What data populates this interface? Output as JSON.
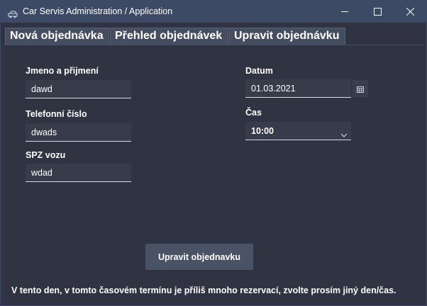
{
  "window": {
    "title": "Car Servis Administration / Application",
    "icon": "car-app-icon",
    "controls": {
      "minimize_icon": "minimize-icon",
      "maximize_icon": "maximize-icon",
      "close_icon": "close-icon"
    }
  },
  "tabs": [
    {
      "label": "Nová objednávka"
    },
    {
      "label": "Přehled objednávek"
    },
    {
      "label": "Upravit objednávku"
    }
  ],
  "form": {
    "name": {
      "label": "Jmeno a přijmení",
      "value": "dawd"
    },
    "phone": {
      "label": "Telefonní číslo",
      "value": "dwads"
    },
    "plate": {
      "label": "SPZ vozu",
      "value": "wdad"
    },
    "date": {
      "label": "Datum",
      "value": "01.03.2021",
      "picker_icon": "calendar-icon"
    },
    "time": {
      "label": "Čas",
      "value": "10:00",
      "dropdown_icon": "chevron-down-icon"
    }
  },
  "submit_label": "Upravit objednavku",
  "warning_text": "V tento den, v tomto časovém termínu je příliš mnoho rezervací, zvolte prosím jiný den/čas.",
  "colors": {
    "background": "#2f3342",
    "titlebar": "#3c4a66",
    "tab": "#454d60",
    "field": "#383c4a",
    "button": "#4a5266",
    "text": "#ffffff"
  }
}
